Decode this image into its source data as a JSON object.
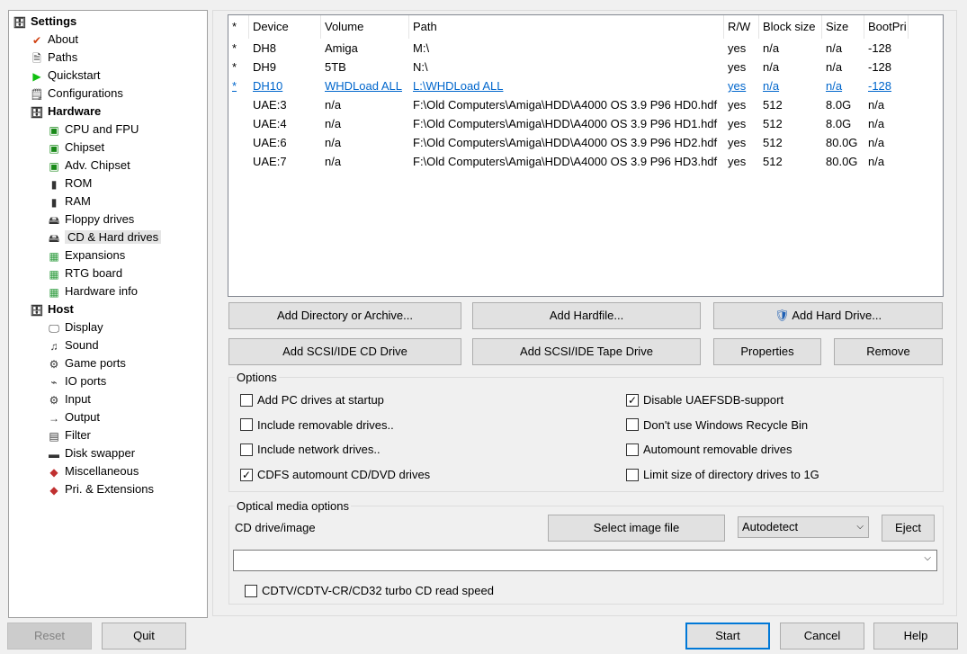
{
  "tree": [
    {
      "label": "Settings",
      "level": 0,
      "bold": true,
      "icon": "settings-icon"
    },
    {
      "label": "About",
      "level": 1,
      "icon": "checkmark-icon"
    },
    {
      "label": "Paths",
      "level": 1,
      "icon": "paths-icon"
    },
    {
      "label": "Quickstart",
      "level": 1,
      "icon": "play-icon"
    },
    {
      "label": "Configurations",
      "level": 1,
      "icon": "configurations-icon"
    },
    {
      "label": "Hardware",
      "level": 1,
      "bold": true,
      "icon": "hardware-icon"
    },
    {
      "label": "CPU and FPU",
      "level": 2,
      "icon": "chip-icon"
    },
    {
      "label": "Chipset",
      "level": 2,
      "icon": "chip-icon"
    },
    {
      "label": "Adv. Chipset",
      "level": 2,
      "icon": "chip-icon"
    },
    {
      "label": "ROM",
      "level": 2,
      "icon": "memory-icon"
    },
    {
      "label": "RAM",
      "level": 2,
      "icon": "memory-icon"
    },
    {
      "label": "Floppy drives",
      "level": 2,
      "icon": "floppy-icon"
    },
    {
      "label": "CD & Hard drives",
      "level": 2,
      "selected": true,
      "icon": "hard-drive-icon"
    },
    {
      "label": "Expansions",
      "level": 2,
      "icon": "expansion-card-icon"
    },
    {
      "label": "RTG board",
      "level": 2,
      "icon": "expansion-card-icon"
    },
    {
      "label": "Hardware info",
      "level": 2,
      "icon": "expansion-card-icon"
    },
    {
      "label": "Host",
      "level": 1,
      "bold": true,
      "icon": "host-icon"
    },
    {
      "label": "Display",
      "level": 2,
      "icon": "display-icon"
    },
    {
      "label": "Sound",
      "level": 2,
      "icon": "sound-icon"
    },
    {
      "label": "Game ports",
      "level": 2,
      "icon": "joystick-icon"
    },
    {
      "label": "IO ports",
      "level": 2,
      "icon": "io-ports-icon"
    },
    {
      "label": "Input",
      "level": 2,
      "icon": "joystick-icon"
    },
    {
      "label": "Output",
      "level": 2,
      "icon": "output-icon"
    },
    {
      "label": "Filter",
      "level": 2,
      "icon": "filter-icon"
    },
    {
      "label": "Disk swapper",
      "level": 2,
      "icon": "disk-swapper-icon"
    },
    {
      "label": "Miscellaneous",
      "level": 2,
      "icon": "misc-icon"
    },
    {
      "label": "Pri. & Extensions",
      "level": 2,
      "icon": "misc-icon"
    }
  ],
  "drives": {
    "columns": [
      "*",
      "Device",
      "Volume",
      "Path",
      "R/W",
      "Block size",
      "Size",
      "BootPri"
    ],
    "rows": [
      [
        "*",
        "DH8",
        "Amiga",
        "M:\\",
        "yes",
        "n/a",
        "n/a",
        "-128"
      ],
      [
        "*",
        "DH9",
        "5TB",
        "N:\\",
        "yes",
        "n/a",
        "n/a",
        "-128"
      ],
      [
        "*",
        "DH10",
        "WHDLoad ALL",
        "L:\\WHDLoad ALL",
        "yes",
        "n/a",
        "n/a",
        "-128"
      ],
      [
        "",
        "UAE:3",
        "n/a",
        "F:\\Old Computers\\Amiga\\HDD\\A4000 OS 3.9 P96 HD0.hdf",
        "yes",
        "512",
        "8.0G",
        "n/a"
      ],
      [
        "",
        "UAE:4",
        "n/a",
        "F:\\Old Computers\\Amiga\\HDD\\A4000 OS 3.9 P96 HD1.hdf",
        "yes",
        "512",
        "8.0G",
        "n/a"
      ],
      [
        "",
        "UAE:6",
        "n/a",
        "F:\\Old Computers\\Amiga\\HDD\\A4000 OS 3.9 P96 HD2.hdf",
        "yes",
        "512",
        "80.0G",
        "n/a"
      ],
      [
        "",
        "UAE:7",
        "n/a",
        "F:\\Old Computers\\Amiga\\HDD\\A4000 OS 3.9 P96 HD3.hdf",
        "yes",
        "512",
        "80.0G",
        "n/a"
      ]
    ],
    "hovered_row": 2
  },
  "buttons": {
    "add_dir": "Add Directory or Archive...",
    "add_hardfile": "Add Hardfile...",
    "add_hard_drive": "Add Hard Drive...",
    "add_cd": "Add SCSI/IDE CD Drive",
    "add_tape": "Add SCSI/IDE Tape Drive",
    "properties": "Properties",
    "remove": "Remove"
  },
  "options": {
    "title": "Options",
    "items": [
      {
        "label": "Add PC drives at startup",
        "checked": false
      },
      {
        "label": "Include removable drives..",
        "checked": false
      },
      {
        "label": "Include network drives..",
        "checked": false
      },
      {
        "label": "CDFS automount CD/DVD drives",
        "checked": true
      },
      {
        "label": "Disable UAEFSDB-support",
        "checked": true
      },
      {
        "label": "Don't use Windows Recycle Bin",
        "checked": false
      },
      {
        "label": "Automount removable drives",
        "checked": false
      },
      {
        "label": "Limit size of directory drives to 1G",
        "checked": false
      }
    ]
  },
  "optical": {
    "title": "Optical media options",
    "cd_label": "CD drive/image",
    "select_image": "Select image file",
    "mode": "Autodetect",
    "eject": "Eject",
    "path_value": "",
    "turbo_label": "CDTV/CDTV-CR/CD32 turbo CD read speed",
    "turbo_checked": false
  },
  "footer": {
    "reset": "Reset",
    "quit": "Quit",
    "start": "Start",
    "cancel": "Cancel",
    "help": "Help"
  },
  "colors": {
    "link": "#0066cc",
    "default_button_border": "#0078d7"
  }
}
